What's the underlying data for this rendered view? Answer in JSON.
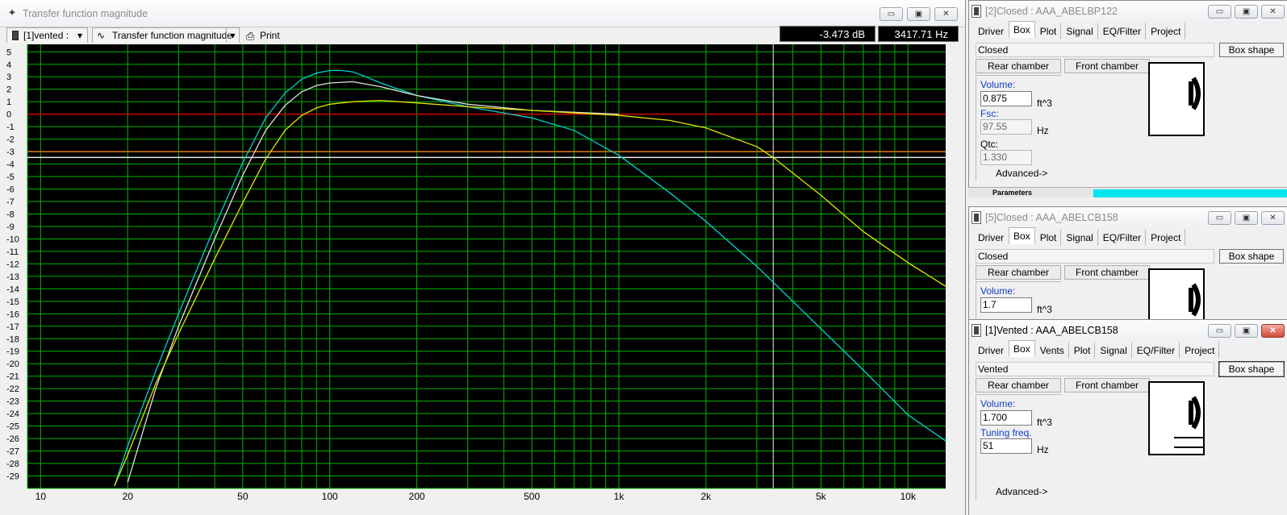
{
  "main_window": {
    "title": "Transfer function magnitude",
    "title_icon": "plot-icon",
    "buttons": {
      "minimize": "▭",
      "maximize": "▣",
      "close": "✕"
    }
  },
  "toolbar": {
    "project_selector": "[1]vented :",
    "graph_selector": "Transfer function magnitude",
    "print_label": "Print"
  },
  "readout": {
    "level": "-3.473 dB",
    "frequency": "3417.71 Hz"
  },
  "chart_data": {
    "type": "line",
    "title": "",
    "xlabel": "",
    "ylabel": "",
    "x_scale": "log",
    "xlim": [
      9,
      13500
    ],
    "ylim": [
      -30,
      5.6
    ],
    "x_tick_labels": [
      "10",
      "20",
      "50",
      "100",
      "200",
      "500",
      "1k",
      "2k",
      "5k",
      "10k"
    ],
    "x_tick_values": [
      10,
      20,
      50,
      100,
      200,
      500,
      1000,
      2000,
      5000,
      10000
    ],
    "y_tick_labels": [
      "5",
      "4",
      "3",
      "2",
      "1",
      "0",
      "-1",
      "-2",
      "-3",
      "-4",
      "-5",
      "-6",
      "-7",
      "-8",
      "-9",
      "-10",
      "-11",
      "-12",
      "-13",
      "-14",
      "-15",
      "-16",
      "-17",
      "-18",
      "-19",
      "-20",
      "-21",
      "-22",
      "-23",
      "-24",
      "-25",
      "-26",
      "-27",
      "-28",
      "-29"
    ],
    "grid": true,
    "background": "#000000",
    "grid_color": "#00b400",
    "reference_lines": [
      {
        "y": 0,
        "color": "#d40000"
      },
      {
        "y": -3,
        "color": "#e07a10"
      },
      {
        "y": -3.473,
        "color": "#e8e8e8"
      }
    ],
    "cursor_x": 3417.71,
    "series": [
      {
        "color": "#00d2d2",
        "x": [
          18,
          20,
          25,
          30,
          40,
          50,
          60,
          70,
          80,
          90,
          100,
          110,
          120,
          130,
          150,
          200,
          300,
          500,
          700,
          1000,
          1500,
          2000,
          3000,
          5000,
          7000,
          10000,
          13500
        ],
        "y": [
          -29.8,
          -26.6,
          -20.6,
          -16.0,
          -9.0,
          -3.9,
          -0.3,
          1.7,
          2.8,
          3.3,
          3.5,
          3.5,
          3.4,
          3.1,
          2.5,
          1.5,
          0.6,
          -0.3,
          -1.3,
          -3.3,
          -6.3,
          -8.6,
          -12.2,
          -17.2,
          -20.5,
          -24.1,
          -26.2
        ]
      },
      {
        "color": "#e0e0e0",
        "x": [
          20,
          25,
          30,
          40,
          50,
          60,
          70,
          80,
          90,
          100,
          120,
          150,
          200,
          300,
          500,
          1000
        ],
        "y": [
          -29.5,
          -22.0,
          -17.0,
          -10.0,
          -4.9,
          -1.3,
          0.7,
          1.8,
          2.3,
          2.5,
          2.6,
          2.2,
          1.5,
          0.8,
          0.3,
          0.0
        ]
      },
      {
        "color": "#e6e600",
        "x": [
          18,
          20,
          25,
          30,
          40,
          50,
          60,
          70,
          80,
          90,
          100,
          120,
          150,
          200,
          300,
          500,
          700,
          1000,
          1500,
          2000,
          3000,
          3417.71,
          5000,
          7000,
          10000,
          13500
        ],
        "y": [
          -29.8,
          -27.3,
          -21.6,
          -17.6,
          -11.6,
          -7.1,
          -3.6,
          -1.3,
          -0.1,
          0.5,
          0.8,
          1.0,
          1.1,
          0.9,
          0.6,
          0.3,
          0.1,
          -0.1,
          -0.5,
          -1.1,
          -2.6,
          -3.473,
          -6.5,
          -9.4,
          -11.9,
          -13.8
        ]
      }
    ]
  },
  "windows": [
    {
      "title": "[2]Closed : AAA_ABELBP122",
      "active": false,
      "tabs": [
        "Driver",
        "Box",
        "Plot",
        "Signal",
        "EQ/Filter",
        "Project"
      ],
      "selected_tab": "Box",
      "box_type": "Closed",
      "box_shape_label": "Box shape",
      "rear_chamber_label": "Rear chamber",
      "front_chamber_label": "Front chamber",
      "volume_label": "Volume:",
      "volume_value": "0.875",
      "volume_unit": "ft^3",
      "fsc_label": "Fsc:",
      "fsc_value": "97.55",
      "fsc_unit": "Hz",
      "qtc_label": "Qtc:",
      "qtc_value": "1.330",
      "advanced_label": "Advanced->"
    },
    {
      "title": "[5]Closed : AAA_ABELCB158",
      "active": false,
      "tabs": [
        "Driver",
        "Box",
        "Plot",
        "Signal",
        "EQ/Filter",
        "Project"
      ],
      "selected_tab": "Box",
      "box_type": "Closed",
      "box_shape_label": "Box shape",
      "rear_chamber_label": "Rear chamber",
      "front_chamber_label": "Front chamber",
      "volume_label": "Volume:",
      "volume_value": "1.7",
      "volume_unit": "ft^3"
    },
    {
      "title": "[1]Vented : AAA_ABELCB158",
      "active": true,
      "tabs": [
        "Driver",
        "Box",
        "Vents",
        "Plot",
        "Signal",
        "EQ/Filter",
        "Project"
      ],
      "selected_tab": "Box",
      "box_type": "Vented",
      "box_shape_label": "Box shape",
      "rear_chamber_label": "Rear chamber",
      "front_chamber_label": "Front chamber",
      "volume_label": "Volume:",
      "volume_value": "1.700",
      "volume_unit": "ft^3",
      "tuning_label": "Tuning freq.",
      "tuning_value": "51",
      "tuning_unit": "Hz",
      "advanced_label": "Advanced->"
    }
  ],
  "status_strip": {
    "label": "Parameters",
    "color": "#00e5f0"
  }
}
